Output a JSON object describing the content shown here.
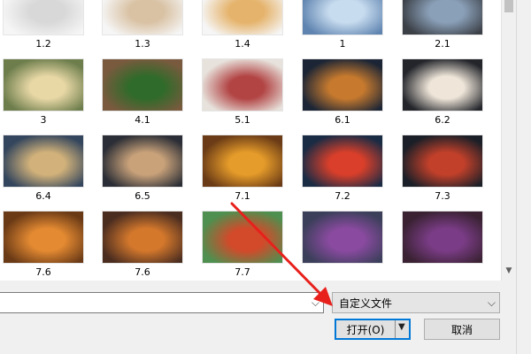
{
  "dialog": {
    "files": [
      {
        "name": "1.2",
        "thumb": "cartoon-sketch-image"
      },
      {
        "name": "1.3",
        "thumb": "cartoon-color-image"
      },
      {
        "name": "1.4",
        "thumb": "cartoon-color-image"
      },
      {
        "name": "1",
        "thumb": "photo-image"
      },
      {
        "name": "2.1",
        "thumb": "photo-image"
      },
      {
        "name": "3",
        "thumb": "photo-image"
      },
      {
        "name": "4.1",
        "thumb": "photo-image"
      },
      {
        "name": "5.1",
        "thumb": "photo-image"
      },
      {
        "name": "6.1",
        "thumb": "photo-image"
      },
      {
        "name": "6.2",
        "thumb": "photo-image"
      },
      {
        "name": "6.4",
        "thumb": "photo-image"
      },
      {
        "name": "6.5",
        "thumb": "photo-image"
      },
      {
        "name": "7.1",
        "thumb": "photo-image"
      },
      {
        "name": "7.2",
        "thumb": "photo-image"
      },
      {
        "name": "7.3",
        "thumb": "photo-image"
      },
      {
        "name": "7.6",
        "thumb": "photo-image"
      },
      {
        "name": "7.6",
        "thumb": "photo-image"
      },
      {
        "name": "7.7",
        "thumb": "photo-image"
      },
      {
        "name": "",
        "thumb": "photo-image"
      },
      {
        "name": "",
        "thumb": "photo-image"
      }
    ],
    "filename": {
      "value": ""
    },
    "filetype": {
      "selected": "自定义文件"
    },
    "buttons": {
      "open": "打开(O)",
      "cancel": "取消"
    }
  },
  "colors": {
    "accent": "#0078d7",
    "annotation": "#e8201c",
    "button_face": "#e1e1e1"
  },
  "icons": {
    "combo_dropdown": "chevron-down-icon",
    "open_split": "triangle-down-icon",
    "scroll_down": "scroll-down-arrow-icon"
  }
}
